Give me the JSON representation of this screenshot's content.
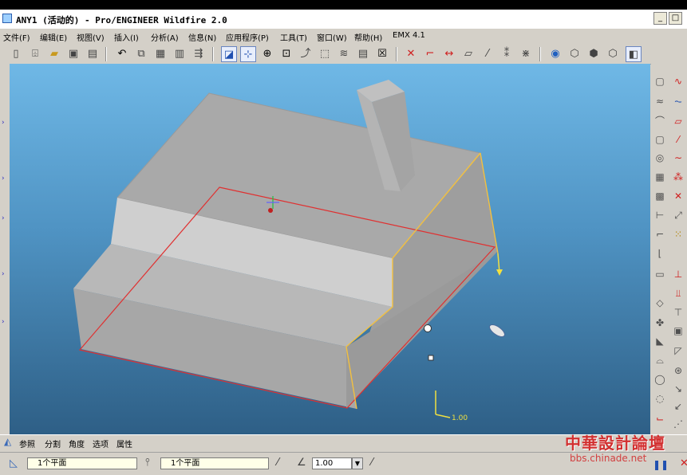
{
  "window": {
    "title": "ANY1 (活动的) - Pro/ENGINEER Wildfire 2.0",
    "min_glyph": "_",
    "restore_glyph": "□"
  },
  "menubar": {
    "items": [
      "文件(F)",
      "编辑(E)",
      "视图(V)",
      "插入(I)",
      "分析(A)",
      "信息(N)",
      "应用程序(P)",
      "工具(T)",
      "窗口(W)",
      "帮助(H)",
      "EMX 4.1"
    ]
  },
  "toolbar": {
    "icons": [
      "new-file-icon",
      "open-icon",
      "folder-icon",
      "save-icon",
      "save-copy-icon",
      "undo-icon",
      "copy-icon",
      "paste-icon",
      "paste-special-icon",
      "regenerate-icon",
      "repaint-icon",
      "spin-center-icon",
      "zoom-in-icon",
      "zoom-fit-icon",
      "orient-icon",
      "saved-views-icon",
      "layers-icon",
      "model-tree-icon",
      "close-window-icon",
      "axis-display-icon",
      "point-display-icon",
      "csys-display-icon",
      "plane-display-icon",
      "plane-tag-icon",
      "point-tag-icon",
      "csys-tag-icon",
      "info-icon",
      "wireframe-icon",
      "hidden-line-icon",
      "no-hidden-icon",
      "shading-icon"
    ]
  },
  "right_toolbar": {
    "icons": [
      "datum-plane-icon",
      "datum-curve-icon",
      "datum-axis-icon",
      "sketch-icon",
      "datum-point-icon",
      "datum-curve-2-icon",
      "coordinate-system-icon",
      "sketched-curve-icon",
      "analysis-icon",
      "point-cross-icon",
      "extrude-icon",
      "point-offset-icon",
      "revolve-icon",
      "point-field-icon",
      "variable-sweep-icon",
      "blend-icon",
      "hole-icon",
      "shell-icon",
      "rib-icon",
      "draft-icon",
      "round-icon",
      "chamfer-icon",
      "copy-feature-icon",
      "mirror-icon",
      "merge-icon",
      "trim-icon",
      "pattern-icon",
      "wrap-icon",
      "offset-icon",
      "thicken-icon",
      "solidify-icon",
      "intersect-icon",
      "project-icon",
      "extend-icon",
      "flatten-icon",
      "sweep-icon"
    ]
  },
  "dashboard": {
    "tabs": [
      "参照",
      "分割",
      "角度",
      "选项",
      "属性"
    ],
    "field1_value": "1个平面",
    "field2_value": "1个平面",
    "angle_value": "1.00"
  },
  "viewport": {
    "dimension_label": "1.00"
  },
  "watermark": {
    "big": "中華設計論壇",
    "small": "bbs.chinade.net"
  },
  "colors": {
    "viewport_top": "#6fb8e6",
    "viewport_bottom": "#2e5f86",
    "model_gray": "#a8a8a8",
    "draft_plane": "#e03030",
    "edge_highlight": "#f2c040"
  }
}
